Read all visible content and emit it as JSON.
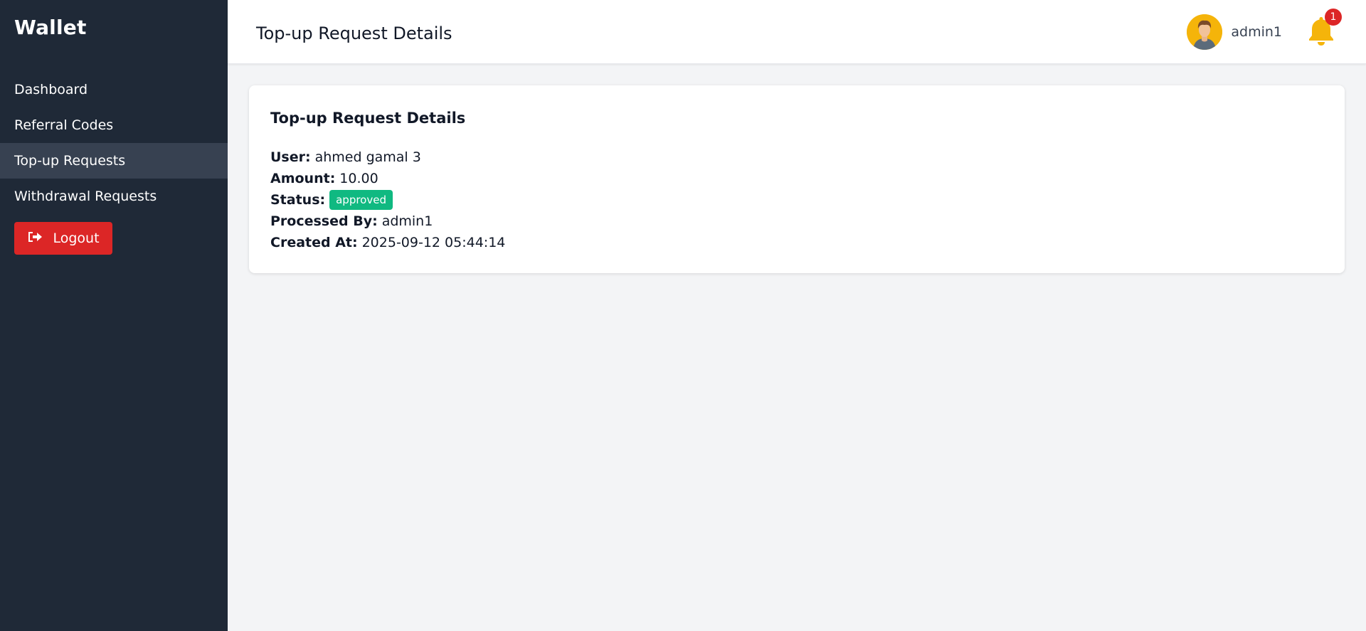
{
  "sidebar": {
    "brand": "Wallet",
    "items": [
      {
        "label": "Dashboard"
      },
      {
        "label": "Referral Codes"
      },
      {
        "label": "Top-up Requests"
      },
      {
        "label": "Withdrawal Requests"
      }
    ],
    "active_index": 2,
    "logout_label": "Logout",
    "logout_icon": "sign-out-icon"
  },
  "header": {
    "title": "Top-up Request Details",
    "username": "admin1",
    "notification_count": "1",
    "notification_icon": "bell-icon"
  },
  "card": {
    "title": "Top-up Request Details",
    "fields": {
      "user": {
        "label": "User:",
        "value": "ahmed gamal 3"
      },
      "amount": {
        "label": "Amount:",
        "value": "10.00"
      },
      "status": {
        "label": "Status:",
        "value": "approved"
      },
      "processed_by": {
        "label": "Processed By:",
        "value": "admin1"
      },
      "created_at": {
        "label": "Created At:",
        "value": "2025-09-12 05:44:14"
      }
    }
  },
  "colors": {
    "sidebar_bg": "#1f2937",
    "active_item_bg": "#374151",
    "logout_bg": "#dc2626",
    "status_badge": "#10b981",
    "bell": "#f5b40a",
    "notification_badge": "#dc2626"
  }
}
